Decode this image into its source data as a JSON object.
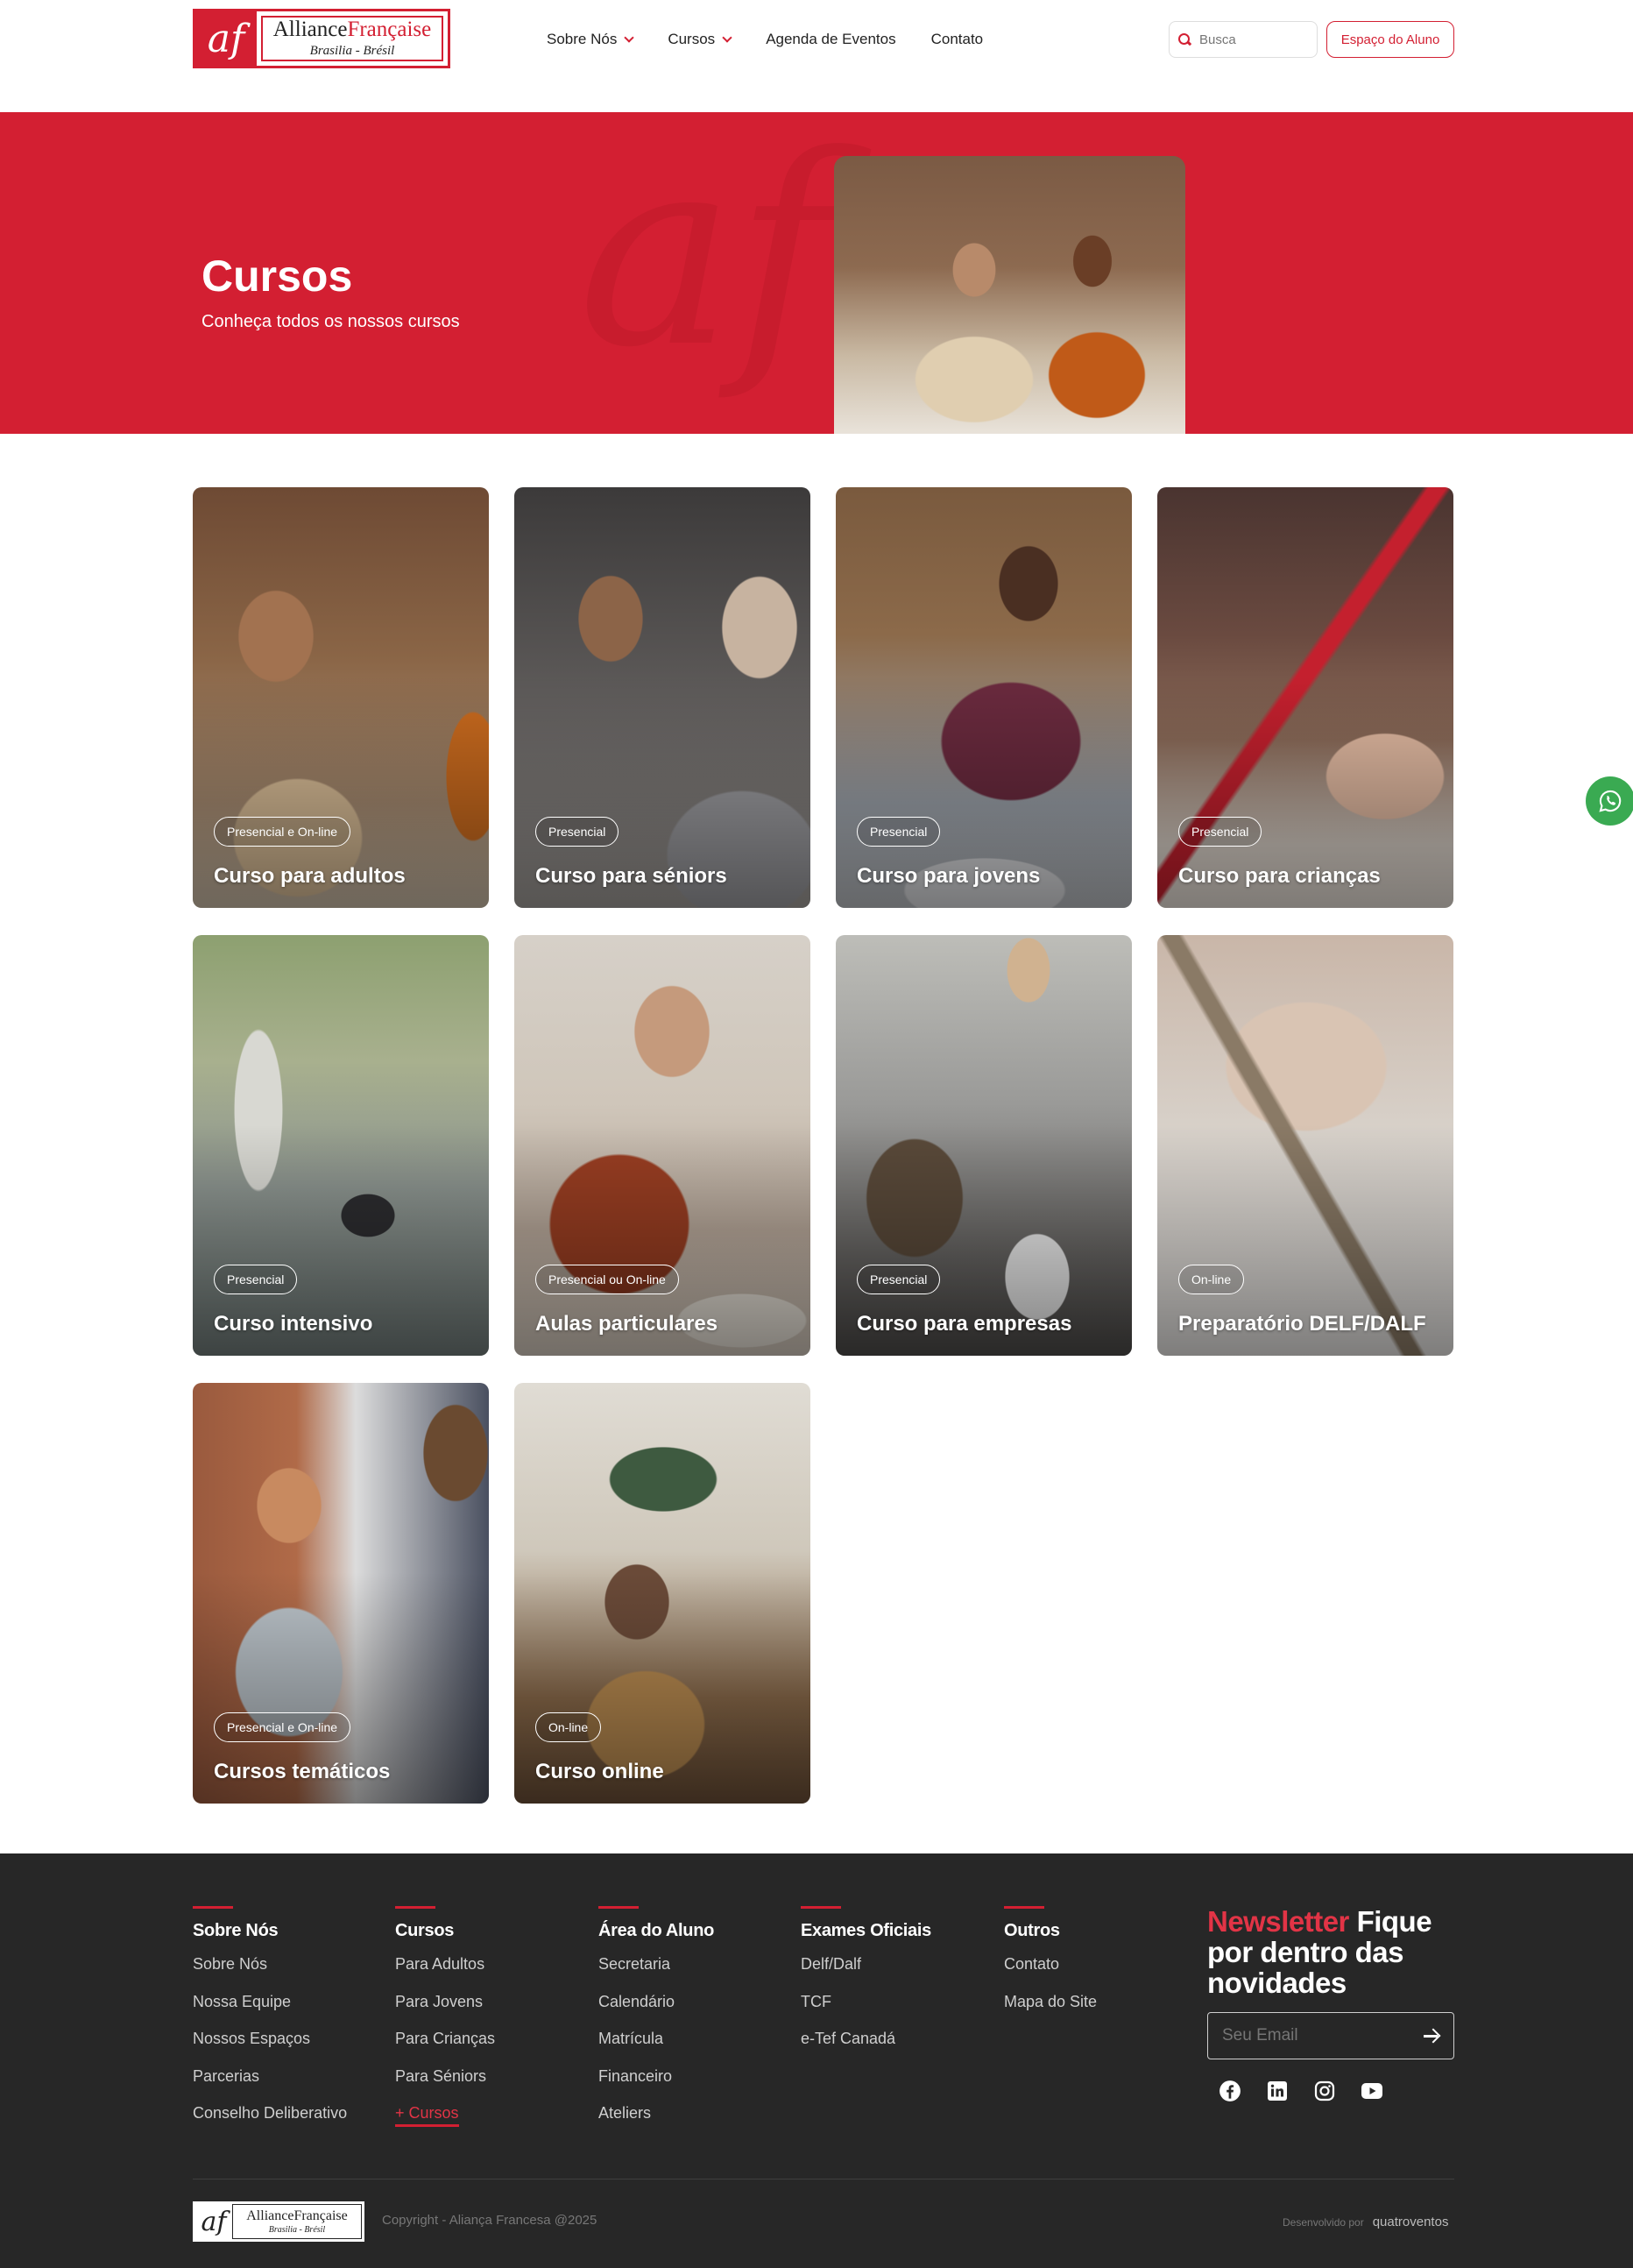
{
  "header": {
    "logo": {
      "mark": "af",
      "name_part1": "Alliance",
      "name_part2": "Française",
      "location": "Brasilia - Brésil"
    },
    "nav": [
      {
        "label": "Sobre Nós",
        "has_dropdown": true
      },
      {
        "label": "Cursos",
        "has_dropdown": true
      },
      {
        "label": "Agenda de Eventos",
        "has_dropdown": false
      },
      {
        "label": "Contato",
        "has_dropdown": false
      }
    ],
    "search": {
      "placeholder": "Busca"
    },
    "student_button": "Espaço do Aluno"
  },
  "hero": {
    "title": "Cursos",
    "subtitle": "Conheça todos os nossos cursos",
    "watermark": "af"
  },
  "courses": [
    {
      "badge": "Presencial e On-line",
      "title": "Curso para adultos"
    },
    {
      "badge": "Presencial",
      "title": "Curso para séniors"
    },
    {
      "badge": "Presencial",
      "title": "Curso para jovens"
    },
    {
      "badge": "Presencial",
      "title": "Curso para crianças"
    },
    {
      "badge": "Presencial",
      "title": "Curso intensivo"
    },
    {
      "badge": "Presencial ou On-line",
      "title": "Aulas particulares"
    },
    {
      "badge": "Presencial",
      "title": "Curso para empresas"
    },
    {
      "badge": "On-line",
      "title": "Preparatório DELF/DALF"
    },
    {
      "badge": "Presencial e On-line",
      "title": "Cursos temáticos"
    },
    {
      "badge": "On-line",
      "title": "Curso online"
    }
  ],
  "footer": {
    "columns": [
      {
        "heading": "Sobre Nós",
        "links": [
          "Sobre Nós",
          "Nossa Equipe",
          "Nossos Espaços",
          "Parcerias",
          "Conselho Deliberativo"
        ]
      },
      {
        "heading": "Cursos",
        "links": [
          "Para Adultos",
          "Para Jovens",
          "Para Crianças",
          "Para Séniors",
          "+ Cursos"
        ]
      },
      {
        "heading": "Área do Aluno",
        "links": [
          "Secretaria",
          "Calendário",
          "Matrícula",
          "Financeiro",
          "Ateliers"
        ]
      },
      {
        "heading": "Exames Oficiais",
        "links": [
          "Delf/Dalf",
          "TCF",
          "e-Tef Canadá"
        ]
      },
      {
        "heading": "Outros",
        "links": [
          "Contato",
          "Mapa do Site"
        ]
      }
    ],
    "newsletter": {
      "title_accent": "Newsletter",
      "title_rest": "Fique por dentro das novidades",
      "email_placeholder": "Seu Email"
    },
    "socials": [
      "facebook-icon",
      "linkedin-icon",
      "instagram-icon",
      "youtube-icon"
    ],
    "bottom_logo": {
      "mark": "af",
      "name": "AllianceFrançaise",
      "location": "Brasilia - Brésil"
    },
    "copyright": "Copyright - Aliança Francesa @2025",
    "developed_by_label": "Desenvolvido por",
    "developer": "quatroventos"
  },
  "colors": {
    "brand_red": "#d31f32",
    "footer_bg": "#272727",
    "whatsapp_green": "#3aaa52"
  }
}
